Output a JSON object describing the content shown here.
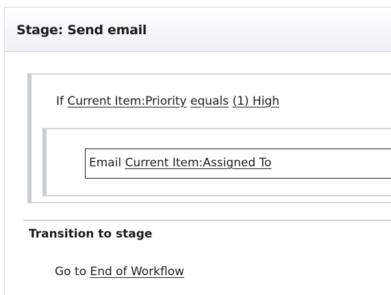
{
  "stage": {
    "title": "Stage: Send email"
  },
  "condition": {
    "keyword": "If",
    "field": "Current Item:Priority",
    "operator": "equals",
    "value": "(1) High"
  },
  "action": {
    "verb": "Email",
    "target": "Current Item:Assigned To"
  },
  "transition": {
    "title": "Transition to stage",
    "goto_prefix": "Go to",
    "goto_target": "End of Workflow"
  }
}
